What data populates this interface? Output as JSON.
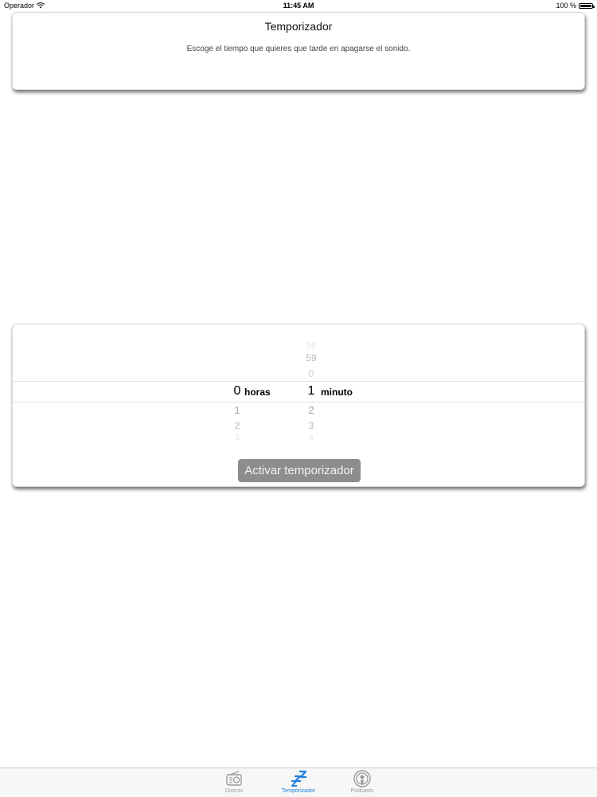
{
  "status_bar": {
    "carrier": "Operador",
    "time": "11:45 AM",
    "battery": "100 %"
  },
  "header_card": {
    "title": "Temporizador",
    "subtitle": "Escoge el tiempo que quieres que tarde en apagarse el sonido."
  },
  "picker": {
    "hours": {
      "above": [],
      "selected": "0",
      "below": [
        "1",
        "2",
        "3"
      ],
      "unit": "horas"
    },
    "minutes": {
      "above": [
        "58",
        "59",
        "0"
      ],
      "selected": "1",
      "below": [
        "2",
        "3",
        "4"
      ],
      "unit": "minuto"
    }
  },
  "activate_button": "Activar temporizador",
  "tabs": [
    {
      "label": "Directo",
      "icon": "radio-icon",
      "active": false
    },
    {
      "label": "Temporizador",
      "icon": "sleep-zzz-icon",
      "active": true
    },
    {
      "label": "Podcasts",
      "icon": "podcasts-icon",
      "active": false
    }
  ],
  "colors": {
    "accent": "#1f7fde",
    "button_bg": "#8d8d8d",
    "tab_inactive": "#9a9a9a"
  }
}
